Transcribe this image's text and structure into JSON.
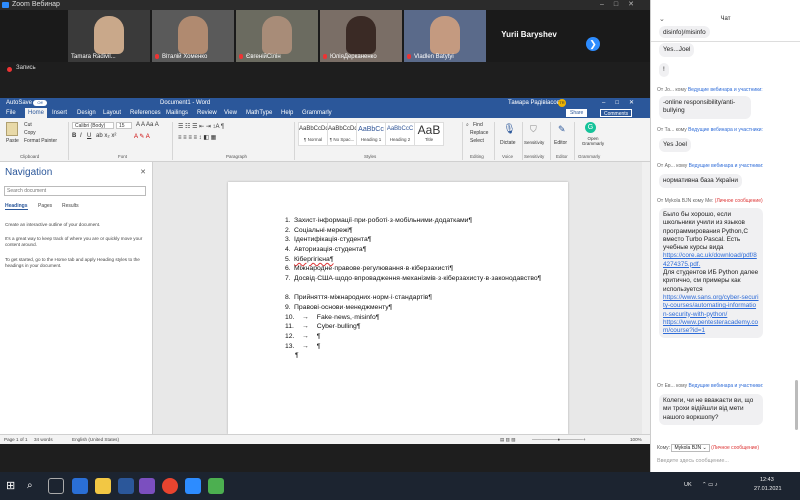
{
  "zoom": {
    "title": "Zoom Вебинар",
    "recording_label": "Запись",
    "participants": [
      {
        "name": "Tamara Radivil..."
      },
      {
        "name": "Віталій Хоменко"
      },
      {
        "name": "ЄвгенійСілін"
      },
      {
        "name": "ЮліяДерканенко"
      },
      {
        "name": "Vladlen Batytyi"
      },
      {
        "name": "Yurii Baryshev"
      }
    ],
    "next_glyph": "❯"
  },
  "word": {
    "autosave": "AutoSave",
    "autosave_state": "Off",
    "doc_title": "Document1 - Word",
    "user": "Тамара Радівіасов",
    "user_initials": "TR",
    "tabs": [
      "File",
      "Home",
      "Insert",
      "Design",
      "Layout",
      "References",
      "Mailings",
      "Review",
      "View",
      "MathType",
      "Help",
      "Grammarly"
    ],
    "share": "Share",
    "comments": "Comments",
    "ribbon": {
      "paste": "Paste",
      "cut": "Cut",
      "copy": "Copy",
      "format_painter": "Format Painter",
      "clipboard": "Clipboard",
      "font_name": "Calibri (Body)",
      "font_size": "15",
      "font": "Font",
      "paragraph": "Paragraph",
      "styles_label": "Styles",
      "styles": [
        {
          "sample": "AaBbCcDd",
          "label": "¶ Normal"
        },
        {
          "sample": "AaBbCcDd",
          "label": "¶ No Spac..."
        },
        {
          "sample": "AaBbCc",
          "label": "Heading 1"
        },
        {
          "sample": "AaBbCcC",
          "label": "Heading 2"
        },
        {
          "sample": "AaB",
          "label": "Title"
        }
      ],
      "find": "Find",
      "replace": "Replace",
      "select": "Select",
      "editing": "Editing",
      "dictate": "Dictate",
      "voice": "Voice",
      "sensitivity": "Sensitivity",
      "sensitivity_group": "Sensitivity",
      "editor": "Editor",
      "editor_group": "Editor",
      "open_grammarly": "Open Grammarly",
      "grammarly_group": "Grammarly"
    },
    "nav": {
      "title": "Navigation",
      "search_placeholder": "Search document",
      "tabs": [
        "Headings",
        "Pages",
        "Results"
      ],
      "help1": "Create an interactive outline of your document.",
      "help2": "It's a great way to keep track of where you are or quickly move your content around.",
      "help3": "To get started, go to the Home tab and apply Heading styles to the headings in your document."
    },
    "list": [
      {
        "num": "1.",
        "text": "Захист·інформації·при·роботі·з·мобільними·додатками¶"
      },
      {
        "num": "2.",
        "text": "Соціальні·мережі¶"
      },
      {
        "num": "3.",
        "text": "Ідентифікація·студента¶"
      },
      {
        "num": "4.",
        "text": "Авторизація·студента¶"
      },
      {
        "num": "5.",
        "text": "Кібергігієна¶"
      },
      {
        "num": "6.",
        "text": "Міжнародне·правове·регулювання·в·кіберзахисті¶"
      },
      {
        "num": "7.",
        "text": "Досвід·США·щодо·впровадження·механізмів·з·кіберзахисту·в·законодавство¶"
      },
      {
        "num": "8.",
        "text": "Прийняття·міжнародних·норм·і·стандартів¶"
      },
      {
        "num": "9.",
        "text": "Правові·основи·менеджменту¶"
      },
      {
        "num": "10.",
        "text": "Fake·news,·misinfo¶"
      },
      {
        "num": "11.",
        "text": "Cyber·bulling¶"
      },
      {
        "num": "12.",
        "text": "¶"
      },
      {
        "num": "13.",
        "text": "¶"
      }
    ],
    "trailing_mark": "¶",
    "status": {
      "page": "Page 1 of 1",
      "words": "34 words",
      "language": "English (United States)",
      "zoom": "100%"
    }
  },
  "chat": {
    "title": "Чат",
    "messages": [
      {
        "text": "disinfo)/misinfo"
      },
      {
        "text": "Yes...Joel"
      },
      {
        "text": "!"
      },
      {
        "meta_from": "От Jo...",
        "meta_to": "кому",
        "meta_target": "Ведущие вебинара и участники:",
        "text": "-online responsibility/anti-bullying"
      },
      {
        "meta_from": "От Та...",
        "meta_to": "кому",
        "meta_target": "Ведущие вебинара и участники:",
        "text": "Yes Joel"
      },
      {
        "meta_from": "От Ар...",
        "meta_to": "кому",
        "meta_target": "Ведущие вебинара и участники:",
        "text": "нормативна база України"
      },
      {
        "meta_from": "От Mykola BJN",
        "meta_to": "кому",
        "meta_target": "Me:",
        "meta_private": "(Личное сообщение)",
        "text": "Было бы хорошо, если школьники учили из языков программирования Python,C вместо Turbo Pascal. Есть учебные курсы вида",
        "link1": "https://core.ac.uk/download/pdf/84274375.pdf.",
        "text2": "Для студентов ИБ Python далее критично, см примеры как используется",
        "link2": "https://www.sans.org/cyber-security-courses/automating-information-security-with-python/",
        "link3": "https://www.pentesteracademy.com/course?id=1"
      },
      {
        "meta_from": "От Ев...",
        "meta_to": "кому",
        "meta_target": "Ведущие вебинара и участники:",
        "text": "Колеги, чи не вважаєти ви, що ми трохи відійшли від мети нашого воркшопу?"
      }
    ],
    "to_label": "Кому:",
    "to_value": "Mykola BJN ⌄",
    "to_private": "(Личное сообщение)",
    "placeholder": "Введите здесь сообщение..."
  },
  "taskbar": {
    "layout": "UK",
    "time": "12:43",
    "date": "27.01.2021"
  }
}
